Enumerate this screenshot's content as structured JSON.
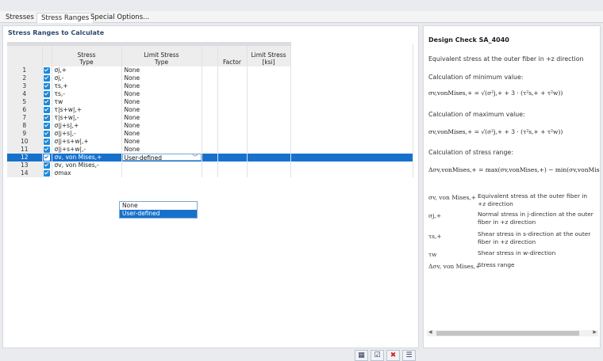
{
  "tabs": [
    {
      "label": "Stresses",
      "active": false
    },
    {
      "label": "Stress Ranges",
      "active": true
    },
    {
      "label": "Special Options...",
      "active": false
    }
  ],
  "left_panel": {
    "title": "Stress Ranges to Calculate",
    "columns": {
      "stress_type": "Stress\nType",
      "limit_stress_type": "Limit Stress\nType",
      "factor": "Factor",
      "limit_stress": "Limit Stress\n[ksi]"
    },
    "rows": [
      {
        "num": "1",
        "type": "σj,+",
        "limit": "None"
      },
      {
        "num": "2",
        "type": "σj,-",
        "limit": "None"
      },
      {
        "num": "3",
        "type": "τs,+",
        "limit": "None"
      },
      {
        "num": "4",
        "type": "τs,-",
        "limit": "None"
      },
      {
        "num": "5",
        "type": "τw",
        "limit": "None"
      },
      {
        "num": "6",
        "type": "τ|s+w|,+",
        "limit": "None"
      },
      {
        "num": "7",
        "type": "τ|s+w|,-",
        "limit": "None"
      },
      {
        "num": "8",
        "type": "σ|j+s|,+",
        "limit": "None"
      },
      {
        "num": "9",
        "type": "σ|j+s|,-",
        "limit": "None"
      },
      {
        "num": "10",
        "type": "σ|j+s+w|,+",
        "limit": "None"
      },
      {
        "num": "11",
        "type": "σ|j+s+w|,-",
        "limit": "None"
      },
      {
        "num": "12",
        "type": "σv, von Mises,+",
        "limit": "User-defined"
      },
      {
        "num": "13",
        "type": "σv, von Mises,-",
        "limit": ""
      },
      {
        "num": "14",
        "type": "σmax",
        "limit": ""
      }
    ],
    "dropdown_options": [
      "None",
      "User-defined"
    ],
    "toolbar_icons": [
      "table-select-icon",
      "check-all-icon",
      "uncheck-all-icon",
      "filter-icon"
    ]
  },
  "right_panel": {
    "title": "Design Check SA_4040",
    "description": "Equivalent stress at the outer fiber in +z direction",
    "min_label": "Calculation of minimum value:",
    "min_formula": "σv,vonMises,+ = √(σ²j,+ + 3 · (τ²s,+ + τ²w))",
    "max_label": "Calculation of maximum value:",
    "max_formula": "σv,vonMises,+ = √(σ²j,+ + 3 · (τ²s,+ + τ²w))",
    "range_label": "Calculation of stress range:",
    "range_formula": "Δσv,vonMises,+ = max(σv,vonMises,+) − min(σv,vonMises,+)",
    "legend": [
      {
        "symbol": "σv, von Mises,+",
        "text": "Equivalent stress at the outer fiber in +z direction"
      },
      {
        "symbol": "σj,+",
        "text": "Normal stress in j-direction at the outer fiber in +z direction"
      },
      {
        "symbol": "τs,+",
        "text": "Shear stress in s-direction at the outer fiber in +z direction"
      },
      {
        "symbol": "τw",
        "text": "Shear stress in w-direction"
      },
      {
        "symbol": "Δσv, von Mises,+",
        "text": "Stress range"
      }
    ]
  },
  "colors": {
    "accent": "#1771cc",
    "checkbox": "#1e88d8",
    "title": "#2a4a6e"
  }
}
